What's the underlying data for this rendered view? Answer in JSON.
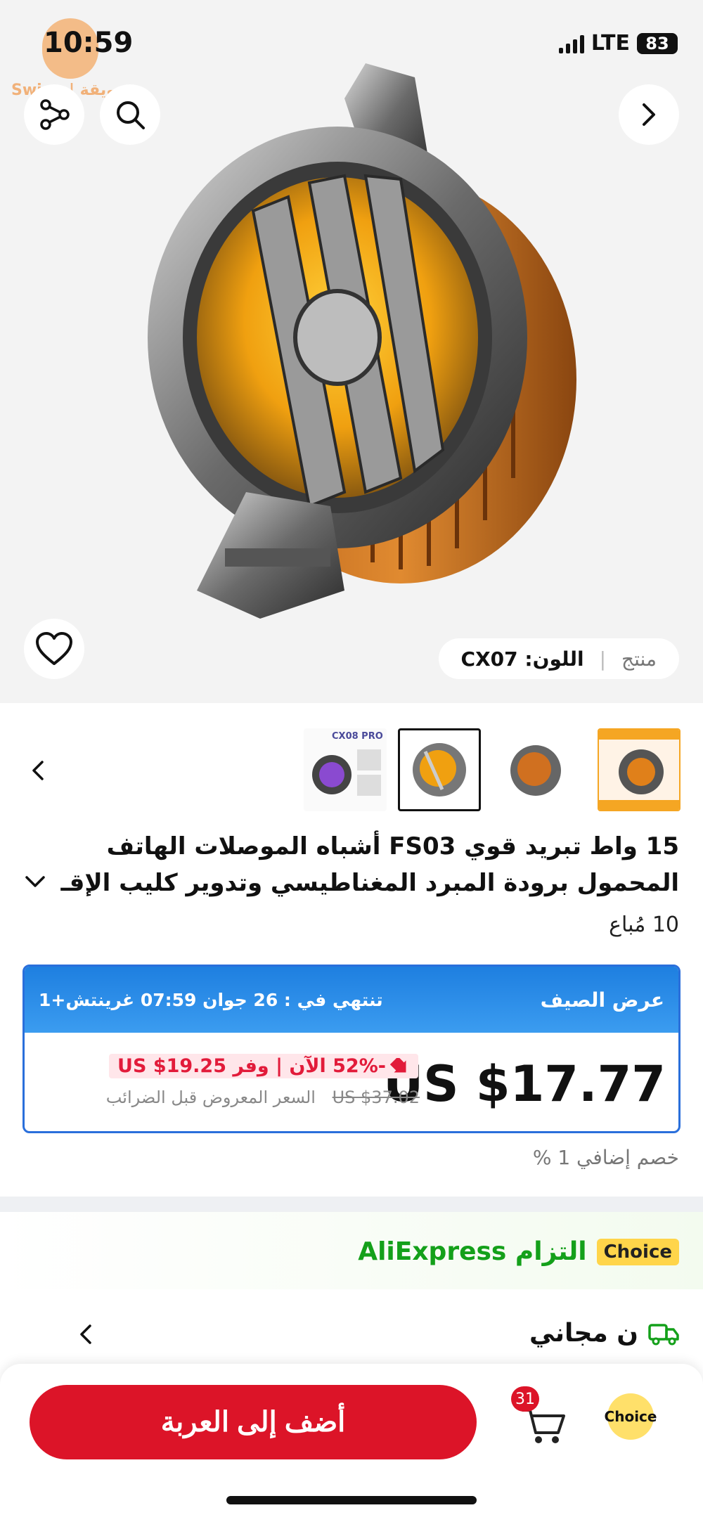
{
  "status_bar": {
    "time": "10:59",
    "network": "LTE",
    "battery": "83"
  },
  "watermark": {
    "text": "Swiqa | سويقة"
  },
  "hero": {
    "variant_label": "منتج",
    "variant_value": "اللون: CX07"
  },
  "thumbnails": {
    "third_caption": "CX08 PRO"
  },
  "product": {
    "title_line1": "15 واط تبريد قوي FS03 أشباه الموصلات الهاتف",
    "title_line2": "المحمول برودة المبرد المغناطيسي وتدوير كليب الإقـ",
    "sold": "10 مُباع"
  },
  "deal": {
    "title": "عرض الصيف",
    "timer": "تنتهي في : 26 جوان 07:59 غرينتش+1",
    "price": "US $17.77",
    "discount": "-52% الآن | وفر US $19.25",
    "old_price": "US $37.02",
    "old_price_label": "السعر المعروض قبل الضرائب"
  },
  "extra_discount": "خصم إضافي 1 %",
  "commitment": {
    "tag": "Choice",
    "text": "التزام AliExpress"
  },
  "shipping": {
    "text": "ن مجاني"
  },
  "bottom_bar": {
    "add_to_cart": "أضف إلى العربة",
    "cart_count": "31",
    "choice_label": "Choice"
  },
  "colors": {
    "accent_red": "#dc1428",
    "deal_blue": "#2a6fdb",
    "choice_yellow": "#ffd54a",
    "commit_green": "#14a01a"
  }
}
